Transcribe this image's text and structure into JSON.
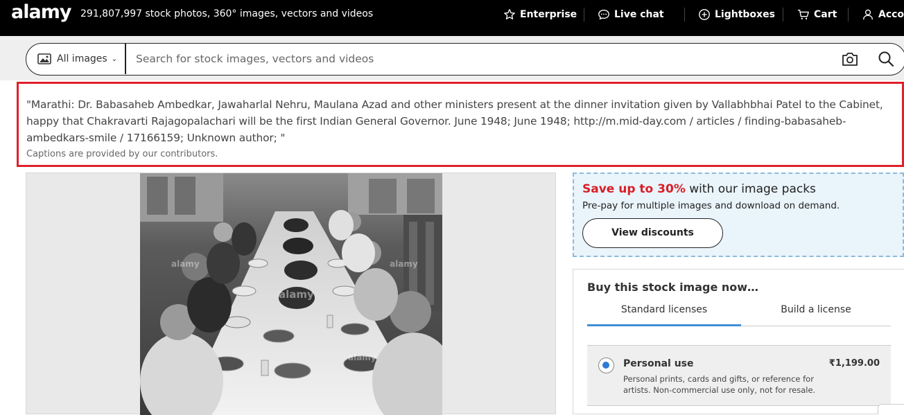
{
  "header": {
    "logo": "alamy",
    "tagline": "291,807,997 stock photos, 360° images, vectors and videos",
    "nav": {
      "enterprise": "Enterprise",
      "live_chat": "Live chat",
      "lightboxes": "Lightboxes",
      "cart": "Cart",
      "account": "Account"
    }
  },
  "search": {
    "filter_label": "All images",
    "placeholder": "Search for stock images, vectors and videos",
    "value": ""
  },
  "caption": {
    "text": "\"Marathi: Dr. Babasaheb Ambedkar, Jawaharlal Nehru, Maulana Azad and other ministers present at the dinner invitation given by Vallabhbhai Patel to the Cabinet, happy that Chakravarti Rajagopalachari will be the first Indian General Governor. June 1948; June 1948; http://m.mid-day.com / articles / finding-babasaheb-ambedkars-smile / 17166159; Unknown author; \"",
    "note": "Captions are provided by our contributors."
  },
  "image": {
    "watermark": "alamy"
  },
  "promo": {
    "highlight": "Save up to 30%",
    "title_rest": " with our image packs",
    "subtitle": "Pre-pay for multiple images and download on demand.",
    "button": "View discounts"
  },
  "buy": {
    "title": "Buy this stock image now…",
    "tabs": [
      "Standard licenses",
      "Build a license"
    ],
    "license": {
      "name": "Personal use",
      "description": "Personal prints, cards and gifts, or reference for artists. Non-commercial use only, not for resale.",
      "price": "₹1,199.00",
      "selected": true
    }
  },
  "colors": {
    "topbar": "#000000",
    "caption_border": "#e0202a",
    "promo_highlight": "#d71f27",
    "tab_active": "#3d8fd6",
    "radio": "#2c7bd6"
  }
}
